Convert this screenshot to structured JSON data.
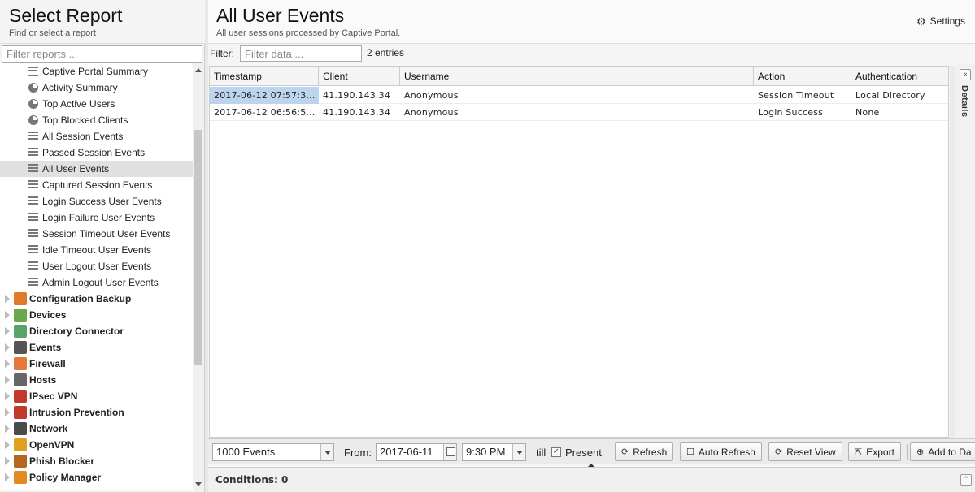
{
  "left": {
    "title": "Select Report",
    "subtitle": "Find or select a report",
    "filter_placeholder": "Filter reports ...",
    "reports": [
      {
        "label": "Captive Portal Summary",
        "icon": "text-icon"
      },
      {
        "label": "Activity Summary",
        "icon": "pie-chart-icon"
      },
      {
        "label": "Top Active Users",
        "icon": "pie-chart-icon"
      },
      {
        "label": "Top Blocked Clients",
        "icon": "pie-chart-icon"
      },
      {
        "label": "All Session Events",
        "icon": "list-icon"
      },
      {
        "label": "Passed Session Events",
        "icon": "list-icon"
      },
      {
        "label": "All User Events",
        "icon": "list-icon",
        "selected": true
      },
      {
        "label": "Captured Session Events",
        "icon": "list-icon"
      },
      {
        "label": "Login Success User Events",
        "icon": "list-icon"
      },
      {
        "label": "Login Failure User Events",
        "icon": "list-icon"
      },
      {
        "label": "Session Timeout User Events",
        "icon": "list-icon"
      },
      {
        "label": "Idle Timeout User Events",
        "icon": "list-icon"
      },
      {
        "label": "User Logout User Events",
        "icon": "list-icon"
      },
      {
        "label": "Admin Logout User Events",
        "icon": "list-icon"
      }
    ],
    "categories": [
      {
        "label": "Configuration Backup",
        "icon": "configuration-backup-icon",
        "color": "#e07a2a"
      },
      {
        "label": "Devices",
        "icon": "devices-icon",
        "color": "#6aa84f"
      },
      {
        "label": "Directory Connector",
        "icon": "directory-connector-icon",
        "color": "#5aa469"
      },
      {
        "label": "Events",
        "icon": "events-icon",
        "color": "#555555"
      },
      {
        "label": "Firewall",
        "icon": "firewall-icon",
        "color": "#e6793a"
      },
      {
        "label": "Hosts",
        "icon": "hosts-icon",
        "color": "#666666"
      },
      {
        "label": "IPsec VPN",
        "icon": "ipsec-vpn-icon",
        "color": "#c0392b"
      },
      {
        "label": "Intrusion Prevention",
        "icon": "intrusion-prevention-icon",
        "color": "#c0392b"
      },
      {
        "label": "Network",
        "icon": "network-icon",
        "color": "#4a4a4a"
      },
      {
        "label": "OpenVPN",
        "icon": "openvpn-icon",
        "color": "#e0a020"
      },
      {
        "label": "Phish Blocker",
        "icon": "phish-blocker-icon",
        "color": "#b5651d"
      },
      {
        "label": "Policy Manager",
        "icon": "policy-manager-icon",
        "color": "#e08a20"
      }
    ]
  },
  "main": {
    "title": "All User Events",
    "subtitle": "All user sessions processed by Captive Portal.",
    "settings_label": "Settings",
    "filter_label": "Filter:",
    "filter_placeholder": "Filter data ...",
    "entries": "2 entries",
    "details_label": "Details",
    "columns": [
      "Timestamp",
      "Client",
      "Username",
      "Action",
      "Authentication"
    ],
    "rows": [
      [
        "2017-06-12 07:57:3...",
        "41.190.143.34",
        "Anonymous",
        "Session Timeout",
        "Local Directory"
      ],
      [
        "2017-06-12 06:56:5...",
        "41.190.143.34",
        "Anonymous",
        "Login Success",
        "None"
      ]
    ]
  },
  "toolbar": {
    "limit": "1000 Events",
    "from_label": "From:",
    "from_date": "2017-06-11",
    "from_time": "9:30 PM",
    "till_label": "till",
    "present_label": "Present",
    "present_checked": true,
    "refresh": "Refresh",
    "auto_refresh": "Auto Refresh",
    "reset_view": "Reset View",
    "export": "Export",
    "add_to_dashboard": "Add to Da"
  },
  "conditions": {
    "label": "Conditions: 0"
  }
}
